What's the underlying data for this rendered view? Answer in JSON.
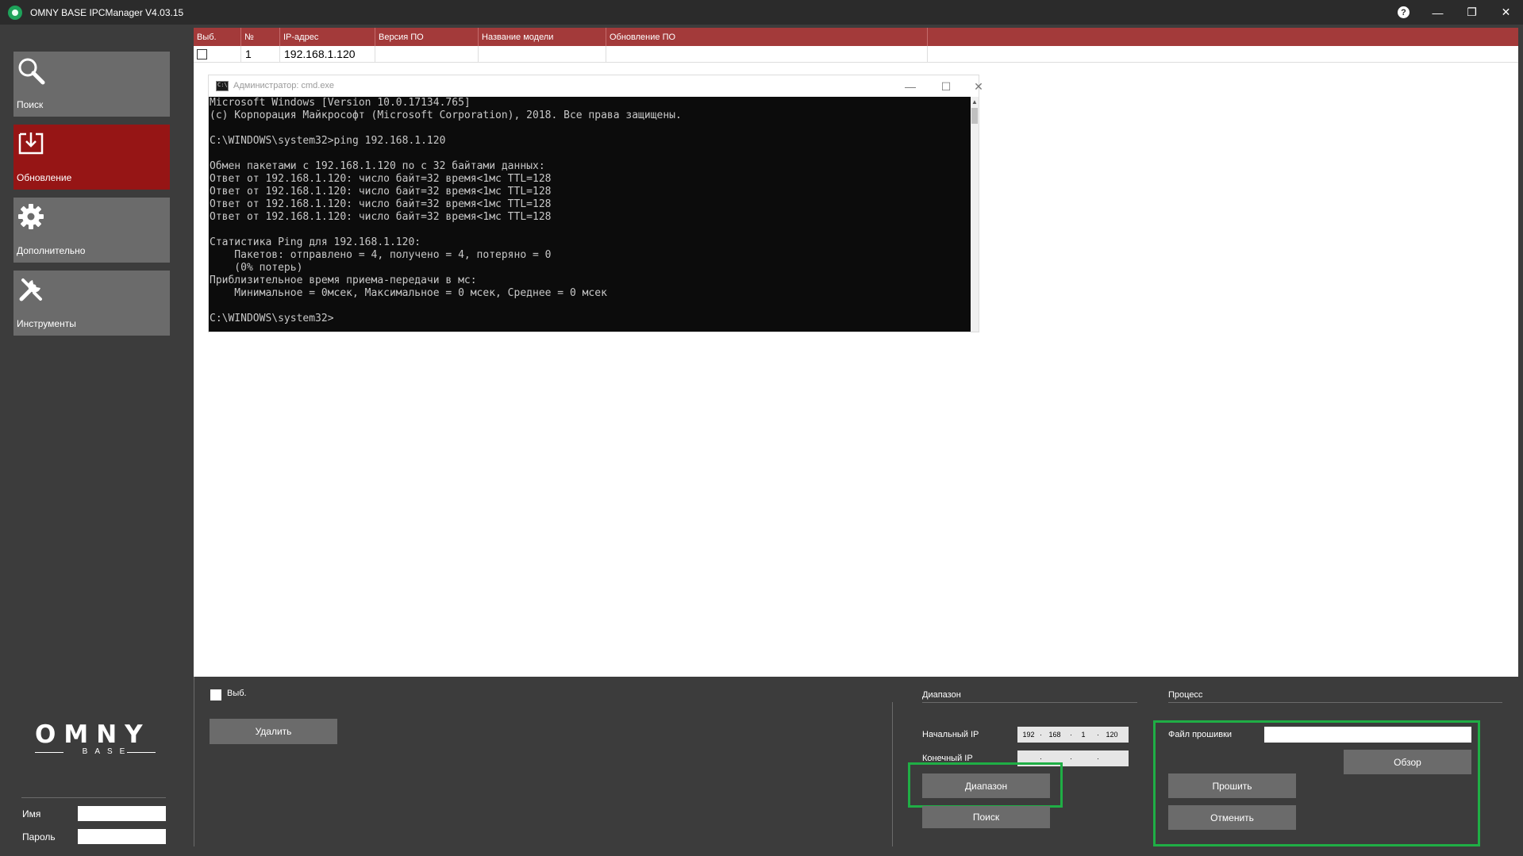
{
  "window": {
    "title": "OMNY BASE IPCManager V4.03.15",
    "help": "?",
    "minimize": "—",
    "restore": "❐",
    "close": "✕"
  },
  "sidebar": {
    "items": [
      {
        "label": "Поиск",
        "icon": "search-icon"
      },
      {
        "label": "Обновление",
        "icon": "download-icon"
      },
      {
        "label": "Дополнительно",
        "icon": "gear-icon"
      },
      {
        "label": "Инструменты",
        "icon": "tools-icon"
      }
    ],
    "logo_main": "OMNY",
    "logo_sub": "BASE",
    "user_label": "Имя",
    "password_label": "Пароль",
    "user_value": "",
    "password_value": ""
  },
  "table": {
    "headers": [
      "Выб.",
      "№",
      "IP-адрес",
      "Версия ПО",
      "Название модели",
      "Обновление ПО"
    ],
    "rows": [
      {
        "num": "1",
        "ip": "192.168.1.120",
        "version": "",
        "model": "",
        "update": ""
      }
    ]
  },
  "cmd": {
    "title": "Администратор: cmd.exe",
    "icon_text": "C:\\",
    "minimize": "—",
    "maximize": "☐",
    "close": "✕",
    "lines": [
      "Microsoft Windows [Version 10.0.17134.765]",
      "(c) Корпорация Майкрософт (Microsoft Corporation), 2018. Все права защищены.",
      "",
      "C:\\WINDOWS\\system32>ping 192.168.1.120",
      "",
      "Обмен пакетами с 192.168.1.120 по с 32 байтами данных:",
      "Ответ от 192.168.1.120: число байт=32 время<1мс TTL=128",
      "Ответ от 192.168.1.120: число байт=32 время<1мс TTL=128",
      "Ответ от 192.168.1.120: число байт=32 время<1мс TTL=128",
      "Ответ от 192.168.1.120: число байт=32 время<1мс TTL=128",
      "",
      "Статистика Ping для 192.168.1.120:",
      "    Пакетов: отправлено = 4, получено = 4, потеряно = 0",
      "    (0% потерь)",
      "Приблизительное время приема-передачи в мс:",
      "    Минимальное = 0мсек, Максимальное = 0 мсек, Среднее = 0 мсек",
      "",
      "C:\\WINDOWS\\system32>"
    ]
  },
  "bottom": {
    "select_label": "Выб.",
    "delete_button": "Удалить",
    "range_group": "Диапазон",
    "start_ip_label": "Начальный IP",
    "end_ip_label": "Конечный IP",
    "start_ip": [
      "192",
      "168",
      "1",
      "120"
    ],
    "end_ip": [
      "",
      "",
      "",
      ""
    ],
    "range_button": "Диапазон",
    "search_button": "Поиск",
    "process_group": "Процесс",
    "firmware_label": "Файл прошивки",
    "firmware_value": "",
    "browse_button": "Обзор",
    "flash_button": "Прошить",
    "cancel_button": "Отменить"
  },
  "colors": {
    "accent_red": "#961515",
    "header_red": "#a33a3a",
    "highlight_green": "#1fae45",
    "panel_gray": "#3c3c3c",
    "button_gray": "#6b6b6b"
  }
}
